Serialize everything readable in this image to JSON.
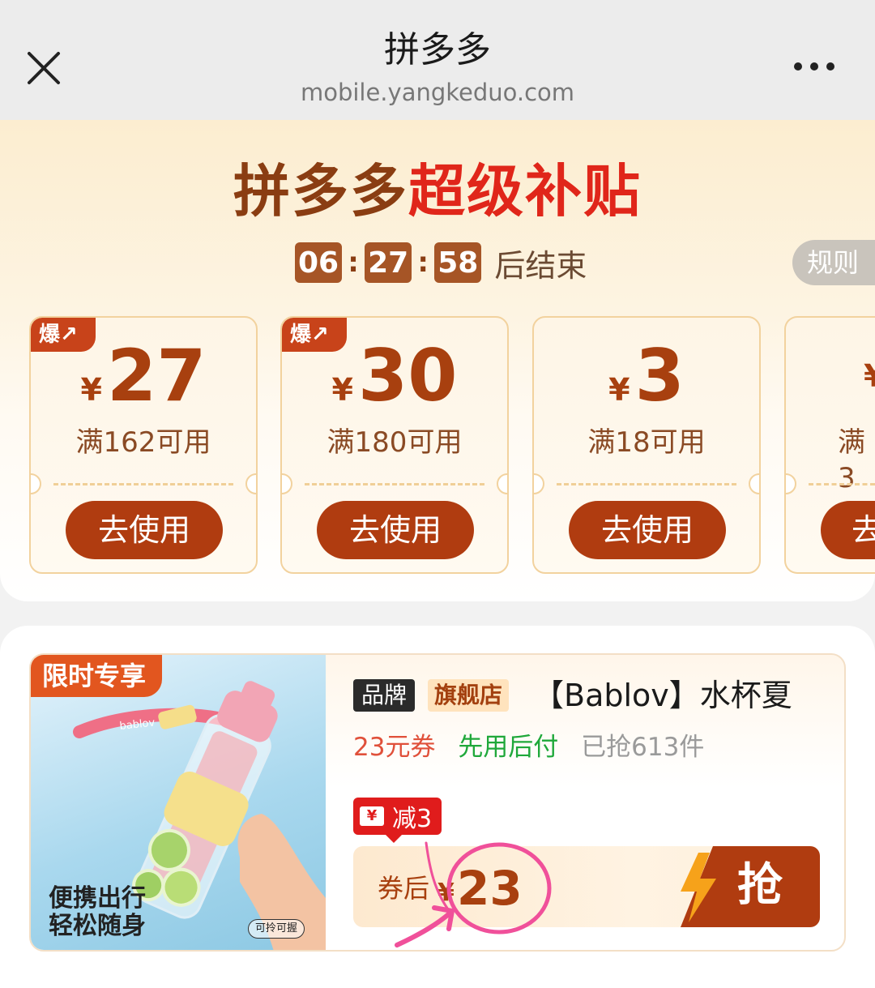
{
  "browser": {
    "title": "拼多多",
    "url": "mobile.yangkeduo.com",
    "close_icon": "close-icon",
    "more_icon": "more-icon"
  },
  "banner": {
    "title_part1": "拼多多",
    "title_part2": "超级补贴",
    "countdown": {
      "hours": "06",
      "minutes": "27",
      "seconds": "58",
      "separator": ":",
      "suffix": "后结束"
    },
    "rules_label": "规则"
  },
  "coupons": [
    {
      "tag": "爆",
      "symbol": "¥",
      "amount": "27",
      "condition": "满162可用",
      "button": "去使用"
    },
    {
      "tag": "爆",
      "symbol": "¥",
      "amount": "30",
      "condition": "满180可用",
      "button": "去使用"
    },
    {
      "tag": "",
      "symbol": "¥",
      "amount": "3",
      "condition": "满18可用",
      "button": "去使用"
    },
    {
      "tag": "",
      "symbol": "¥",
      "amount": "",
      "condition": "满3",
      "button": "去"
    }
  ],
  "product": {
    "image_tag": "限时专享",
    "image_caption_line1": "便携出行",
    "image_caption_line2": "轻松随身",
    "image_badge": "可拎可握",
    "image_brand_text": "bablov",
    "brand_tag": "品牌",
    "store_tag": "旗舰店",
    "title": "【Bablov】水杯夏",
    "coupon_text": "23元券",
    "pay_later": "先用后付",
    "sold": "已抢613件",
    "discount_icon": "¥",
    "discount": "减3",
    "price_label": "券后",
    "price_symbol": "¥",
    "price": "23",
    "grab_button": "抢"
  },
  "colors": {
    "brand_brown": "#a8400f",
    "brand_red": "#e0261a",
    "button_brown": "#b03c10",
    "green": "#1fa83a",
    "annotation_pink": "#f0509a"
  }
}
